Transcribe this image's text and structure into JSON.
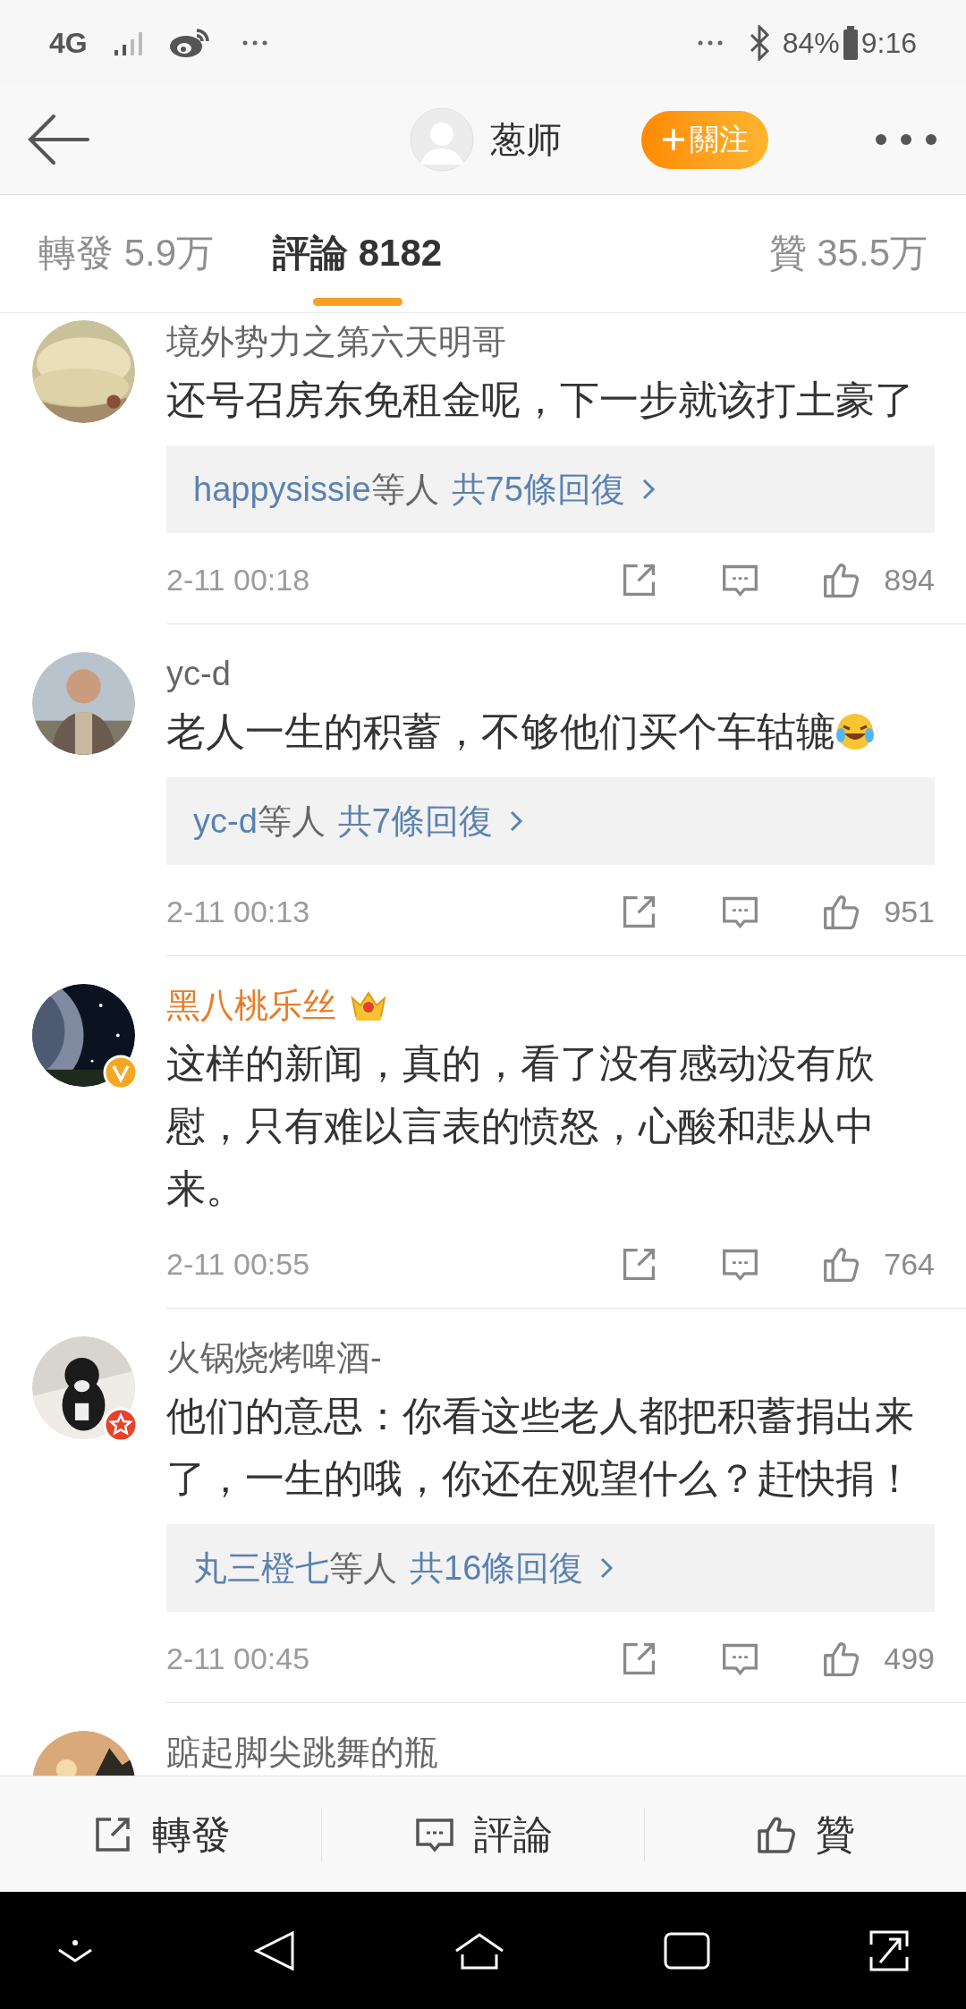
{
  "status_bar": {
    "network": "4G",
    "battery": "84%",
    "time": "9:16"
  },
  "header": {
    "name": "葱师",
    "follow_button": "關注"
  },
  "tabs": [
    {
      "label": "轉發 5.9万",
      "selected": false
    },
    {
      "label": "評論 8182",
      "selected": true
    },
    {
      "label": "贊 35.5万",
      "selected": false
    }
  ],
  "comments": [
    {
      "name": "境外势力之第六天明哥",
      "vip": false,
      "verified": false,
      "starred": false,
      "text": "还号召房东免租金呢，下一步就该打土豪了",
      "emoji": false,
      "replies": {
        "users": "happysissie",
        "suffix": "等人",
        "count": "共75條回復"
      },
      "time": "2-11 00:18",
      "likes": "894"
    },
    {
      "name": "yc-d",
      "vip": false,
      "verified": false,
      "starred": false,
      "text": "老人一生的积蓄，不够他们买个车轱辘",
      "emoji": true,
      "replies": {
        "users": "yc-d",
        "suffix": "等人",
        "count": "共7條回復"
      },
      "time": "2-11 00:13",
      "likes": "951"
    },
    {
      "name": "黑八桃乐丝",
      "vip": true,
      "verified": true,
      "starred": false,
      "text": "这样的新闻，真的，看了没有感动没有欣慰，只有难以言表的愤怒，心酸和悲从中来。",
      "emoji": false,
      "time": "2-11 00:55",
      "likes": "764"
    },
    {
      "name": "火锅烧烤啤酒-",
      "vip": false,
      "verified": false,
      "starred": true,
      "text": "他们的意思：你看这些老人都把积蓄捐出来了，一生的哦，你还在观望什么？赶快捐！",
      "emoji": false,
      "replies": {
        "users": "丸三橙七",
        "suffix": "等人",
        "count": "共16條回復"
      },
      "time": "2-11 00:45",
      "likes": "499"
    },
    {
      "name": "踮起脚尖跳舞的瓶"
    }
  ],
  "bottom_bar": [
    {
      "kind": "share",
      "label": "轉發"
    },
    {
      "kind": "comment",
      "label": "評論"
    },
    {
      "kind": "like",
      "label": "贊"
    }
  ]
}
